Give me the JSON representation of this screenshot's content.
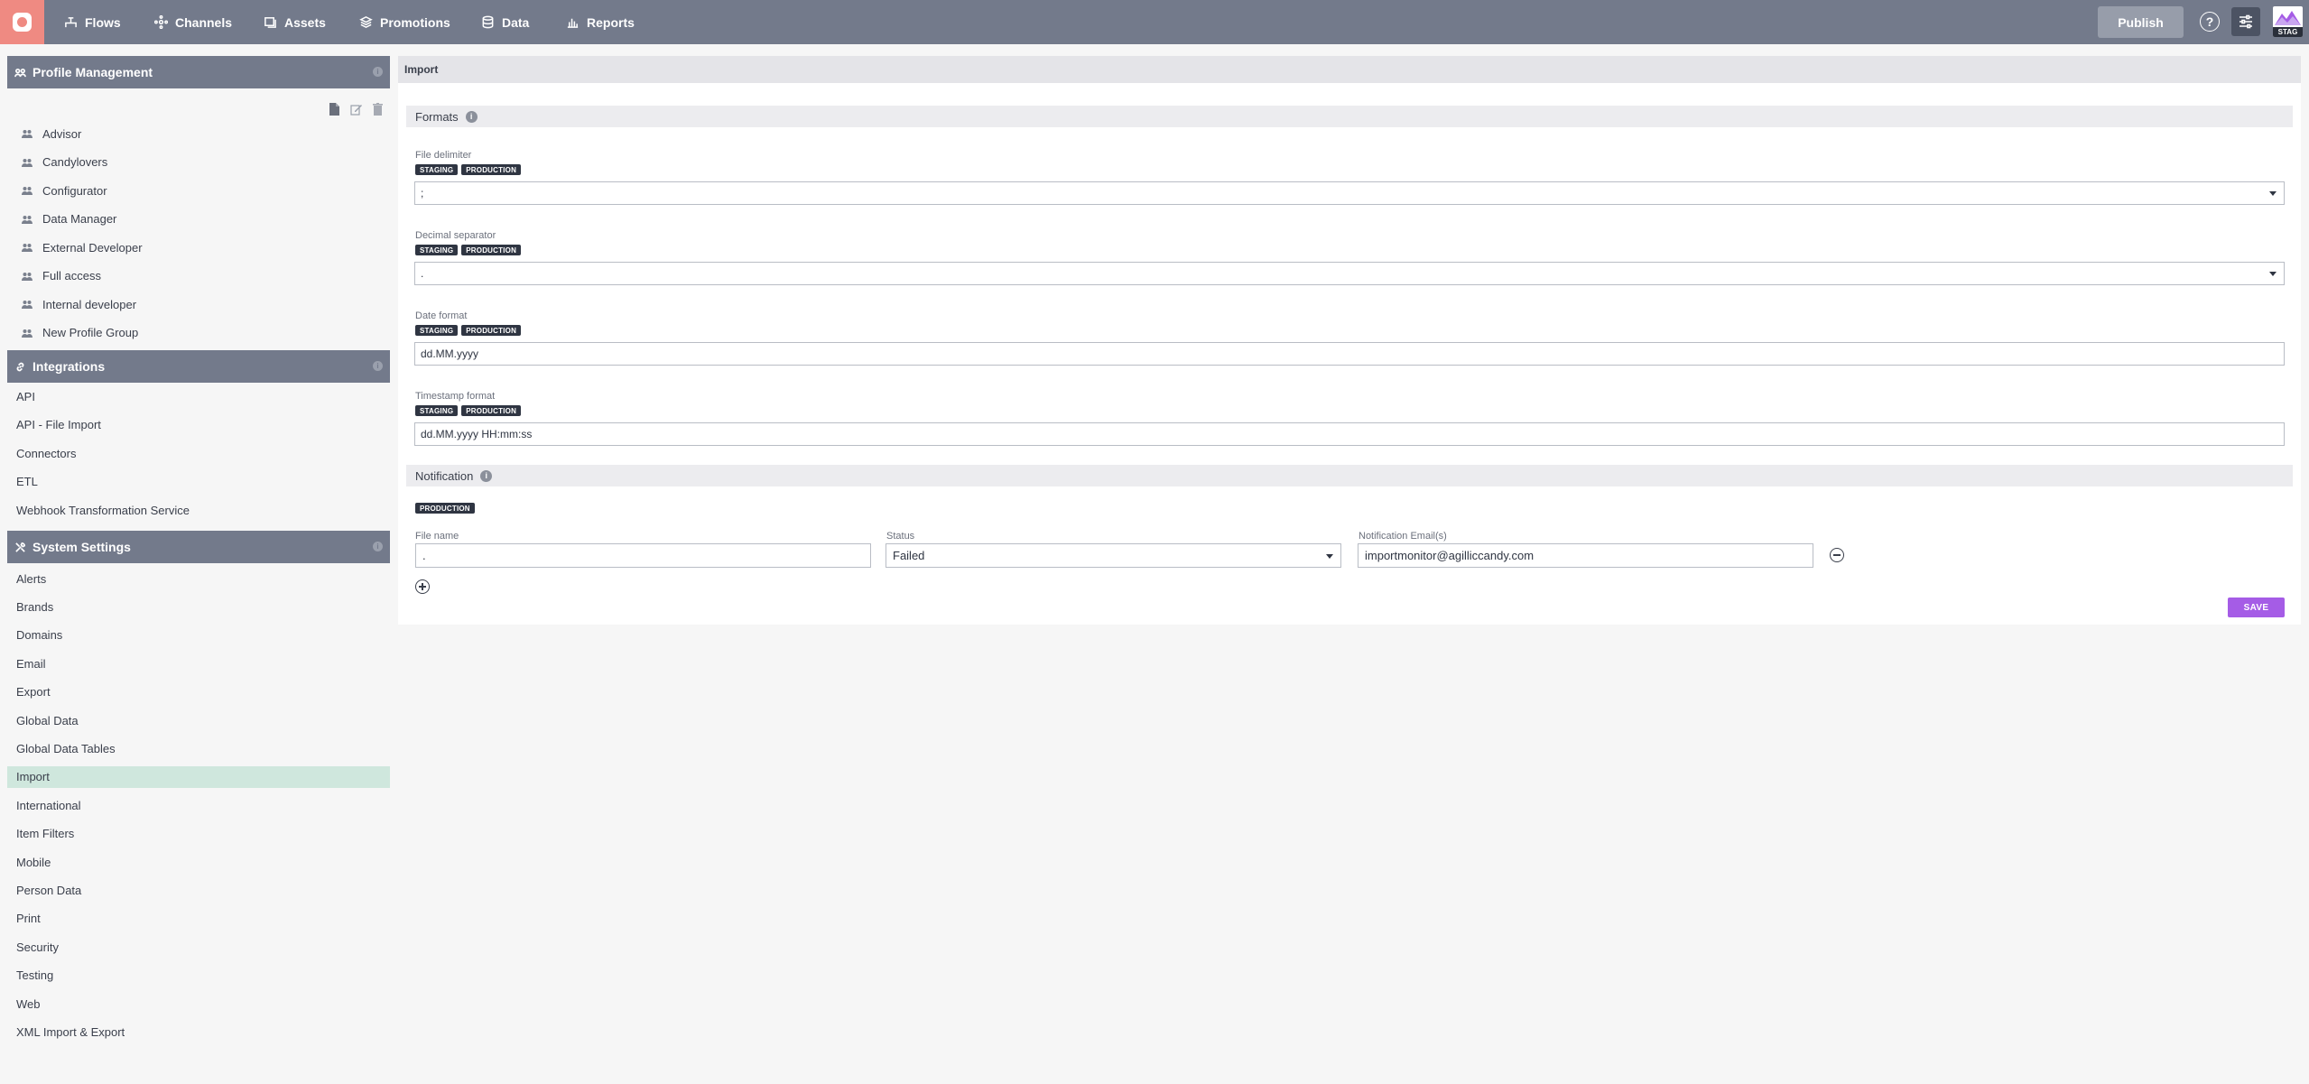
{
  "nav": {
    "items": [
      {
        "label": "Flows",
        "icon": "flows-icon"
      },
      {
        "label": "Channels",
        "icon": "channels-icon"
      },
      {
        "label": "Assets",
        "icon": "assets-icon"
      },
      {
        "label": "Promotions",
        "icon": "promotions-icon"
      },
      {
        "label": "Data",
        "icon": "data-icon"
      },
      {
        "label": "Reports",
        "icon": "reports-icon"
      }
    ],
    "publish_label": "Publish",
    "help_label": "?",
    "env_label": "STAG"
  },
  "sidebar": {
    "profile_management": {
      "title": "Profile Management",
      "items": [
        "Advisor",
        "Candylovers",
        "Configurator",
        "Data Manager",
        "External Developer",
        "Full access",
        "Internal developer",
        "New Profile Group"
      ]
    },
    "integrations": {
      "title": "Integrations",
      "items": [
        "API",
        "API - File Import",
        "Connectors",
        "ETL",
        "Webhook Transformation Service"
      ]
    },
    "system_settings": {
      "title": "System Settings",
      "items": [
        "Alerts",
        "Brands",
        "Domains",
        "Email",
        "Export",
        "Global Data",
        "Global Data Tables",
        "Import",
        "International",
        "Item Filters",
        "Mobile",
        "Person Data",
        "Print",
        "Security",
        "Testing",
        "Web",
        "XML Import & Export"
      ],
      "active": "Import"
    },
    "info_label": "i"
  },
  "main": {
    "title": "Import",
    "formats": {
      "title": "Formats",
      "info_label": "i",
      "fields": [
        {
          "label": "File delimiter",
          "tags": [
            "STAGING",
            "PRODUCTION"
          ],
          "value": ";",
          "type": "select"
        },
        {
          "label": "Decimal separator",
          "tags": [
            "STAGING",
            "PRODUCTION"
          ],
          "value": ".",
          "type": "select"
        },
        {
          "label": "Date format",
          "tags": [
            "STAGING",
            "PRODUCTION"
          ],
          "value": "dd.MM.yyyy",
          "type": "text"
        },
        {
          "label": "Timestamp format",
          "tags": [
            "STAGING",
            "PRODUCTION"
          ],
          "value": "dd.MM.yyyy HH:mm:ss",
          "type": "text"
        }
      ]
    },
    "notification": {
      "title": "Notification",
      "info_label": "i",
      "tag": "PRODUCTION",
      "file_name_label": "File name",
      "file_name_value": ".",
      "status_label": "Status",
      "status_value": "Failed",
      "emails_label": "Notification Email(s)",
      "emails_value": "importmonitor@agilliccandy.com"
    },
    "save_label": "SAVE"
  },
  "colors": {
    "topbar": "#737a8b",
    "logo": "#ef8a82",
    "active_item": "#cfe7dd",
    "save_button": "#a55ce6",
    "tag": "#2f3542"
  }
}
